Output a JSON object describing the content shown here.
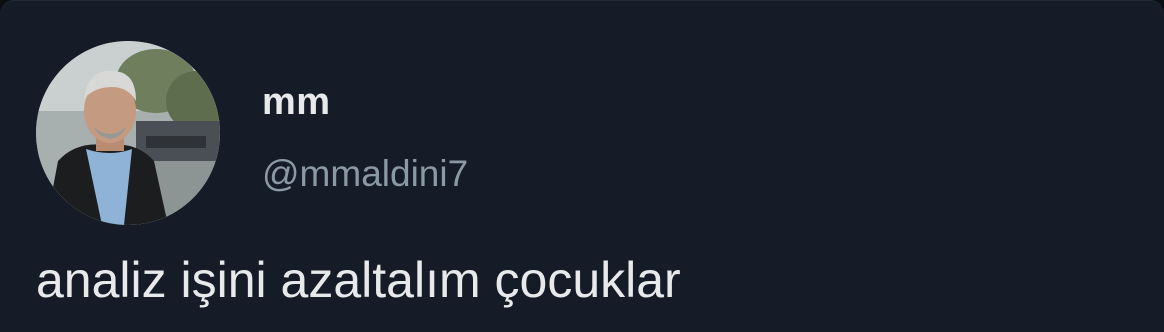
{
  "tweet": {
    "display_name": "mm",
    "handle": "@mmaldini7",
    "text": "analiz işini azaltalım çocuklar",
    "avatar_icon": "profile-photo-icon"
  },
  "colors": {
    "card_background": "#161c27",
    "primary_text": "#e7e9ea",
    "secondary_text": "#8b98a5"
  }
}
